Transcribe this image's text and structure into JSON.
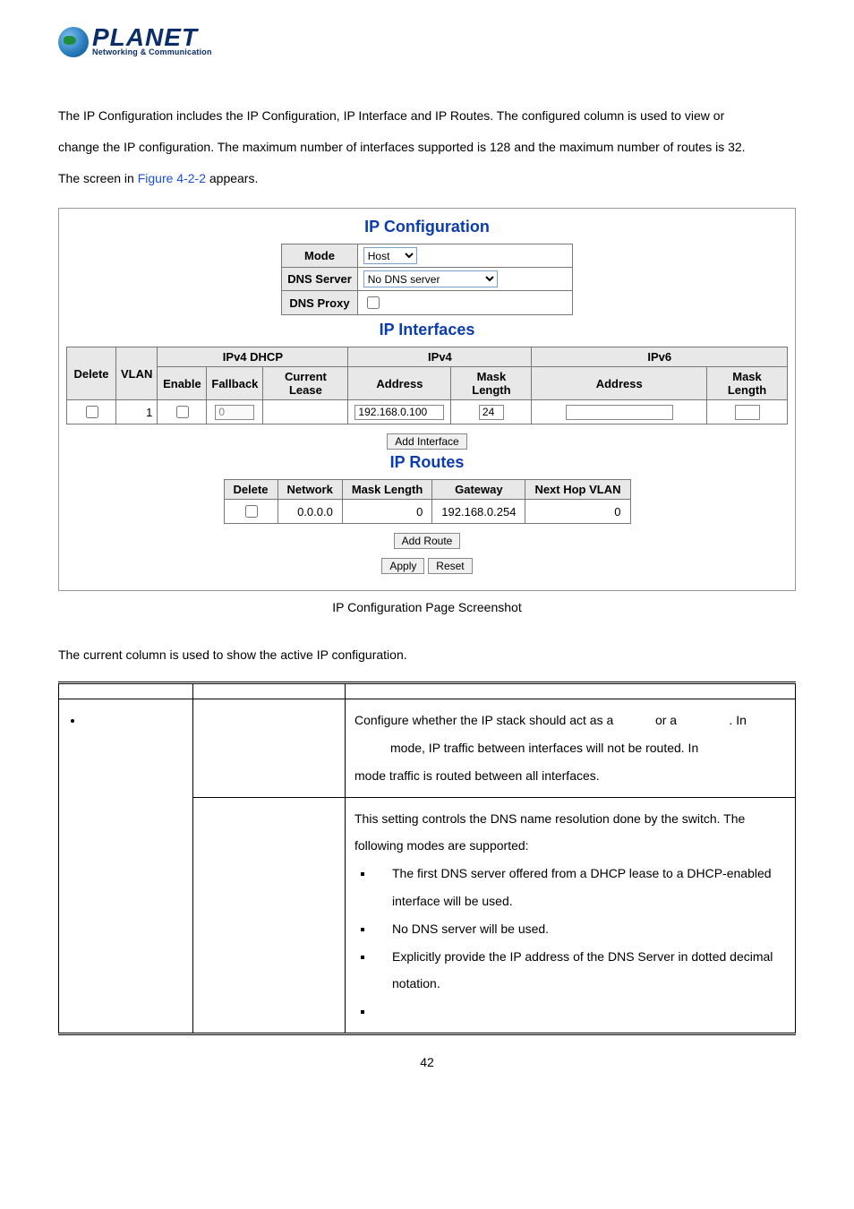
{
  "logo": {
    "brand": "PLANET",
    "tagline": "Networking & Communication"
  },
  "intro": {
    "line1a": "The IP Configuration includes the IP Configuration, IP Interface and IP Routes. The configured column is used to view or",
    "line2a": "change the IP configuration. The maximum number of interfaces supported is 128 and the maximum number of routes is 32.",
    "line3_prefix": "The screen in ",
    "figure_ref": "Figure 4-2-2",
    "line3_suffix": " appears."
  },
  "panel": {
    "title_config": "IP Configuration",
    "mode_label": "Mode",
    "mode_value": "Host",
    "dns_server_label": "DNS Server",
    "dns_server_value": "No DNS server",
    "dns_proxy_label": "DNS Proxy",
    "title_interfaces": "IP Interfaces",
    "if_headers": {
      "delete": "Delete",
      "vlan": "VLAN",
      "ipv4_dhcp": "IPv4 DHCP",
      "ipv4": "IPv4",
      "ipv6": "IPv6",
      "enable": "Enable",
      "fallback": "Fallback",
      "current_lease": "Current Lease",
      "address": "Address",
      "mask_length": "Mask Length"
    },
    "if_row": {
      "vlan": "1",
      "fallback": "0",
      "ipv4_address": "192.168.0.100",
      "ipv4_mask": "24",
      "ipv6_address": "",
      "ipv6_mask": ""
    },
    "btn_add_interface": "Add Interface",
    "title_routes": "IP Routes",
    "rt_headers": {
      "delete": "Delete",
      "network": "Network",
      "mask_length": "Mask Length",
      "gateway": "Gateway",
      "next_hop_vlan": "Next Hop VLAN"
    },
    "rt_row": {
      "network": "0.0.0.0",
      "mask_length": "0",
      "gateway": "192.168.0.254",
      "next_hop_vlan": "0"
    },
    "btn_add_route": "Add Route",
    "btn_apply": "Apply",
    "btn_reset": "Reset"
  },
  "caption": "IP Configuration Page Screenshot",
  "current_line": "The current column is used to show the active IP configuration.",
  "desc": {
    "mode_l1": "Configure whether the IP stack should act as a",
    "mode_l1b": "or a",
    "mode_l1c": ". In",
    "mode_l2": "mode, IP traffic between interfaces will not be routed. In",
    "mode_l3": "mode traffic is routed between all interfaces.",
    "dns_l1": "This setting controls the DNS name resolution done by the switch. The",
    "dns_l2": "following modes are supported:",
    "dns_b1a": "The first DNS server offered from a DHCP lease to a DHCP-enabled",
    "dns_b1b": "interface will be used.",
    "dns_b2": "No DNS server will be used.",
    "dns_b3a": "Explicitly provide the IP address of the DNS Server in dotted decimal",
    "dns_b3b": "notation."
  },
  "page_number": "42"
}
